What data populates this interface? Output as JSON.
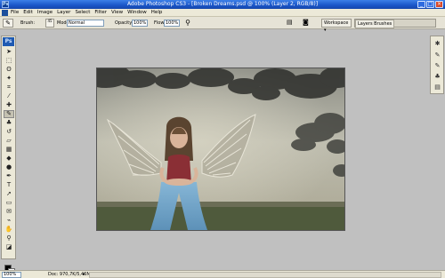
{
  "window": {
    "title": "Adobe Photoshop CS3 - [Broken Dreams.psd @ 100% (Layer 2, RGB/8)]"
  },
  "menu": [
    "File",
    "Edit",
    "Image",
    "Layer",
    "Select",
    "Filter",
    "View",
    "Window",
    "Help"
  ],
  "options": {
    "brush_label": "Brush:",
    "brush_size": "45",
    "mode_label": "Mode:",
    "mode_value": "Normal",
    "opacity_label": "Opacity:",
    "opacity_value": "100%",
    "flow_label": "Flow:",
    "flow_value": "100%",
    "workspace_label": "Workspace"
  },
  "palette_well": {
    "tabs": [
      "Layers",
      "Brushes"
    ]
  },
  "status": {
    "zoom": "100%",
    "doc": "Doc: 970,7K/5,46M"
  },
  "toolbox": {
    "logo": "Ps"
  },
  "colors": {
    "foreground": "#000000",
    "background": "#ffffff",
    "titlebar": "#1a55c8"
  }
}
